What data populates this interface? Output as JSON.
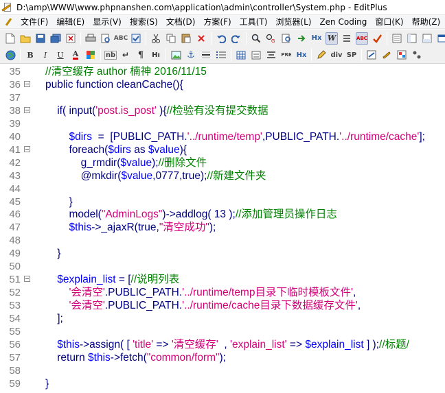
{
  "title": "D:\\amp\\WWW\\www.phpnanshen.com\\application\\admin\\controller\\System.php - EditPlus",
  "menu": [
    "文件(F)",
    "编辑(E)",
    "显示(V)",
    "搜索(S)",
    "文档(D)",
    "方案(F)",
    "工具(T)",
    "浏览器(L)",
    "Zen Coding",
    "窗口(K)",
    "帮助(Z)"
  ],
  "toolbar1_icons": [
    "new-file-icon",
    "open-folder-icon",
    "save-icon",
    "save-all-icon",
    "close-file-icon",
    "print-icon",
    "print-preview-icon",
    "spell-check-icon",
    "check-icon",
    "cut-icon",
    "copy-icon",
    "paste-icon",
    "delete-icon",
    "undo-icon",
    "redo-icon",
    "find-icon",
    "replace-icon",
    "find-in-files-icon",
    "go-to-line-icon",
    "ruler-icon",
    "heading-icon",
    "word-wrap-icon",
    "line-numbers-icon",
    "abc-icon",
    "checkmark-icon",
    "cliptext-icon",
    "directory-icon",
    "output-icon",
    "window-icon",
    "monitor-icon"
  ],
  "toolbar2_icons": [
    "browser-icon",
    "bold-icon",
    "italic-icon",
    "underline-icon",
    "font-color-icon",
    "color-picker-icon",
    "nbsp-icon",
    "br-icon",
    "paragraph-icon",
    "hi-icon",
    "image-icon",
    "anchor-icon",
    "hr-icon",
    "list-icon",
    "table-icon",
    "form-icon",
    "center-icon",
    "pre-icon",
    "div-icon",
    "span-icon",
    "edit-icon",
    "link-icon",
    "script-icon"
  ],
  "toolbar_text": {
    "bold": "B",
    "italic": "I",
    "underline": "U",
    "font_color": "A",
    "nbsp": "nb",
    "br": "↵",
    "paragraph": "¶",
    "hi": "Hı",
    "pre": "PRE",
    "div": "div",
    "span": "SP",
    "hx": "Hx",
    "abc": "ABC",
    "heading": "Hx"
  },
  "lines": [
    {
      "n": "35",
      "fold": false,
      "tokens": [
        {
          "t": "//清空缓存 author 楠神 2016/11/15",
          "c": "c-cmt"
        }
      ]
    },
    {
      "n": "36",
      "fold": true,
      "tokens": [
        {
          "t": "public function cleanCache(){",
          "c": "c-plain"
        }
      ]
    },
    {
      "n": "37",
      "fold": false,
      "tokens": []
    },
    {
      "n": "38",
      "fold": true,
      "tokens": [
        {
          "t": "    if( input(",
          "c": "c-plain"
        },
        {
          "t": "'post.is_post'",
          "c": "c-str"
        },
        {
          "t": " ){",
          "c": "c-plain"
        },
        {
          "t": "//检验有没有提交数据",
          "c": "c-cmt"
        }
      ]
    },
    {
      "n": "39",
      "fold": false,
      "tokens": []
    },
    {
      "n": "40",
      "fold": false,
      "tokens": [
        {
          "t": "        $dirs",
          "c": "c-var"
        },
        {
          "t": "  =  [PUBLIC_PATH.",
          "c": "c-plain"
        },
        {
          "t": "'../runtime/temp'",
          "c": "c-str"
        },
        {
          "t": ",PUBLIC_PATH.",
          "c": "c-plain"
        },
        {
          "t": "'../runtime/cache'",
          "c": "c-str"
        },
        {
          "t": "];",
          "c": "c-plain"
        }
      ]
    },
    {
      "n": "41",
      "fold": true,
      "tokens": [
        {
          "t": "        foreach(",
          "c": "c-plain"
        },
        {
          "t": "$dirs",
          "c": "c-var"
        },
        {
          "t": " as ",
          "c": "c-plain"
        },
        {
          "t": "$value",
          "c": "c-var"
        },
        {
          "t": "){",
          "c": "c-plain"
        }
      ]
    },
    {
      "n": "42",
      "fold": false,
      "tokens": [
        {
          "t": "            g_rmdir(",
          "c": "c-plain"
        },
        {
          "t": "$value",
          "c": "c-var"
        },
        {
          "t": ");",
          "c": "c-plain"
        },
        {
          "t": "//删除文件",
          "c": "c-cmt"
        }
      ]
    },
    {
      "n": "43",
      "fold": false,
      "tokens": [
        {
          "t": "            @mkdir(",
          "c": "c-plain"
        },
        {
          "t": "$value",
          "c": "c-var"
        },
        {
          "t": ",0777,true);",
          "c": "c-plain"
        },
        {
          "t": "//新建文件夹",
          "c": "c-cmt"
        }
      ]
    },
    {
      "n": "44",
      "fold": false,
      "tokens": []
    },
    {
      "n": "45",
      "fold": false,
      "tokens": [
        {
          "t": "        }",
          "c": "c-plain"
        }
      ]
    },
    {
      "n": "46",
      "fold": false,
      "tokens": [
        {
          "t": "        model(",
          "c": "c-plain"
        },
        {
          "t": "\"AdminLogs\"",
          "c": "c-str"
        },
        {
          "t": ")->addlog( 13 );",
          "c": "c-plain"
        },
        {
          "t": "//添加管理员操作日志",
          "c": "c-cmt"
        }
      ]
    },
    {
      "n": "47",
      "fold": false,
      "tokens": [
        {
          "t": "        $this",
          "c": "c-var"
        },
        {
          "t": "->_ajaxR(true,",
          "c": "c-plain"
        },
        {
          "t": "\"清空成功\"",
          "c": "c-str"
        },
        {
          "t": ");",
          "c": "c-plain"
        }
      ]
    },
    {
      "n": "48",
      "fold": false,
      "tokens": []
    },
    {
      "n": "49",
      "fold": false,
      "tokens": [
        {
          "t": "    }",
          "c": "c-plain"
        }
      ]
    },
    {
      "n": "50",
      "fold": false,
      "tokens": []
    },
    {
      "n": "51",
      "fold": true,
      "tokens": [
        {
          "t": "    $explain_list",
          "c": "c-var"
        },
        {
          "t": " = [",
          "c": "c-plain"
        },
        {
          "t": "//说明列表",
          "c": "c-cmt"
        }
      ]
    },
    {
      "n": "52",
      "fold": false,
      "tokens": [
        {
          "t": "        '会清空'",
          "c": "c-str"
        },
        {
          "t": ".PUBLIC_PATH.",
          "c": "c-plain"
        },
        {
          "t": "'../runtime/temp目录下临时模板文件'",
          "c": "c-str"
        },
        {
          "t": ",",
          "c": "c-plain"
        }
      ]
    },
    {
      "n": "53",
      "fold": false,
      "tokens": [
        {
          "t": "        '会清空'",
          "c": "c-str"
        },
        {
          "t": ".PUBLIC_PATH.",
          "c": "c-plain"
        },
        {
          "t": "'../runtime/cache目录下数据缓存文件'",
          "c": "c-str"
        },
        {
          "t": ",",
          "c": "c-plain"
        }
      ]
    },
    {
      "n": "54",
      "fold": false,
      "tokens": [
        {
          "t": "    ];",
          "c": "c-plain"
        }
      ]
    },
    {
      "n": "55",
      "fold": false,
      "tokens": []
    },
    {
      "n": "56",
      "fold": false,
      "tokens": [
        {
          "t": "    $this",
          "c": "c-var"
        },
        {
          "t": "->assign( [ ",
          "c": "c-plain"
        },
        {
          "t": "'title'",
          "c": "c-str"
        },
        {
          "t": " => ",
          "c": "c-plain"
        },
        {
          "t": "'清空缓存'",
          "c": "c-str"
        },
        {
          "t": "  , ",
          "c": "c-plain"
        },
        {
          "t": "'explain_list'",
          "c": "c-str"
        },
        {
          "t": " => ",
          "c": "c-plain"
        },
        {
          "t": "$explain_list",
          "c": "c-var"
        },
        {
          "t": " ] );",
          "c": "c-plain"
        },
        {
          "t": "//标题/",
          "c": "c-cmt"
        }
      ]
    },
    {
      "n": "57",
      "fold": false,
      "tokens": [
        {
          "t": "    return ",
          "c": "c-plain"
        },
        {
          "t": "$this",
          "c": "c-var"
        },
        {
          "t": "->fetch(",
          "c": "c-plain"
        },
        {
          "t": "\"common/form\"",
          "c": "c-str"
        },
        {
          "t": ");",
          "c": "c-plain"
        }
      ]
    },
    {
      "n": "58",
      "fold": false,
      "tokens": []
    },
    {
      "n": "59",
      "fold": false,
      "tokens": [
        {
          "t": "}",
          "c": "c-plain"
        }
      ]
    }
  ]
}
